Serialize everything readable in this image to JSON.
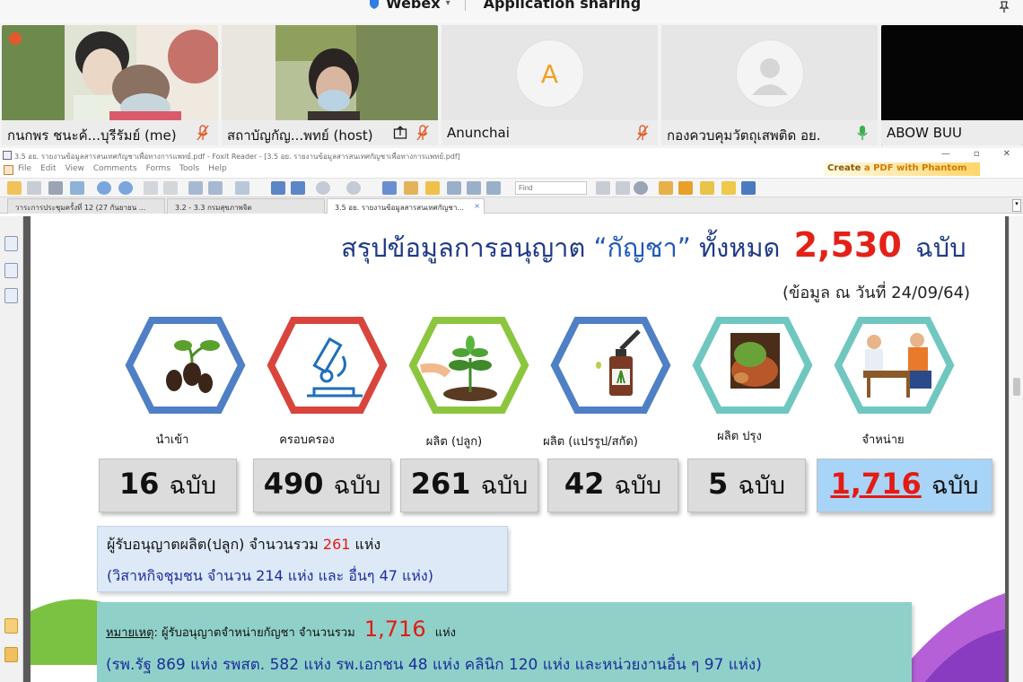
{
  "webex": {
    "app_name": "Webex",
    "mode": "Application sharing"
  },
  "participants": [
    {
      "name": "กนกพร ชนะค้...บุรีรัมย์ (me)",
      "muted": true
    },
    {
      "name": "สถาบัญกัญ...พทย์ (host)",
      "muted": true,
      "sharing": true
    },
    {
      "name": "Anunchai",
      "muted": true,
      "avatar_letter": "A"
    },
    {
      "name": "กองควบคุมวัตถุเสพติด อย.",
      "muted": false
    },
    {
      "name": "ABOW BUU"
    }
  ],
  "foxit": {
    "title": "3.5 อย. รายงานข้อมูลสารสนเทศกัญชาเพื่อทางการแพทย์.pdf - Foxit Reader - [3.5 อย. รายงานข้อมูลสารสนเทศกัญชาเพื่อทางการแพทย์.pdf]",
    "menu": [
      "File",
      "Edit",
      "View",
      "Comments",
      "Forms",
      "Tools",
      "Help"
    ],
    "phantom_banner_prefix": "Create ",
    "phantom_banner_rest": "a PDF with Phantom",
    "find_placeholder": "Find",
    "tabs": [
      {
        "label": "วาระการประชุมครั้งที่ 12 (27 กันยายน ...",
        "active": false
      },
      {
        "label": "3.2 - 3.3 กรมสุขภาพจิต",
        "active": false
      },
      {
        "label": "3.5 อย. รายงานข้อมูลสารสนเทศกัญชา...",
        "active": true
      }
    ],
    "tab_close": "×",
    "window_controls": {
      "minimize": "—",
      "restore": "▫",
      "close": "✕"
    }
  },
  "pdf": {
    "heading_prefix": "สรุปข้อมูลการอนุญาต",
    "heading_quote": "“กัญชา”",
    "heading_mid": "ทั้งหมด",
    "heading_total": "2,530",
    "heading_unit": "ฉบับ",
    "date_note": "(ข้อมูล ณ วันที่ 24/09/64)",
    "categories": [
      {
        "label": "นำเข้า",
        "count": "16",
        "unit": "ฉบับ",
        "icon": "seed-icon",
        "color": "#4f7fc4"
      },
      {
        "label": "ครอบครอง",
        "count": "490",
        "unit": "ฉบับ",
        "icon": "microscope-icon",
        "color": "#d9453c"
      },
      {
        "label": "ผลิต (ปลูก)",
        "count": "261",
        "unit": "ฉบับ",
        "icon": "plant-icon",
        "color": "#8cc63f"
      },
      {
        "label": "ผลิต (แปรรูป/สกัด)",
        "count": "42",
        "unit": "ฉบับ",
        "icon": "extract-bottle-icon",
        "color": "#4f7fc4"
      },
      {
        "label": "ผลิต ปรุง",
        "count": "5",
        "unit": "ฉบับ",
        "icon": "herbal-compress-icon",
        "color": "#6fc7c0"
      },
      {
        "label": "จำหน่าย",
        "count": "1,716",
        "unit": "ฉบับ",
        "icon": "doctor-patient-icon",
        "color": "#6fc7c0"
      }
    ],
    "box1": {
      "line1_prefix": "ผู้รับอนุญาตผลิต(ปลูก) จำนวนรวม",
      "line1_value": "261",
      "line1_suffix": "แห่ง",
      "line2": "(วิสาหกิจชุมชน จำนวน 214 แห่ง และ อื่นๆ 47 แห่ง)"
    },
    "box2": {
      "note_label": "หมายเหตุ",
      "line1_prefix": ": ผู้รับอนุญาตจำหน่ายกัญชา จำนวนรวม",
      "line1_value": "1,716",
      "line1_suffix": "แห่ง",
      "line2": "(รพ.รัฐ 869 แห่ง รพสต. 582 แห่ง รพ.เอกชน 48 แห่ง คลินิก 120 แห่ง และหน่วยงานอื่น ๆ 97 แห่ง)"
    }
  }
}
